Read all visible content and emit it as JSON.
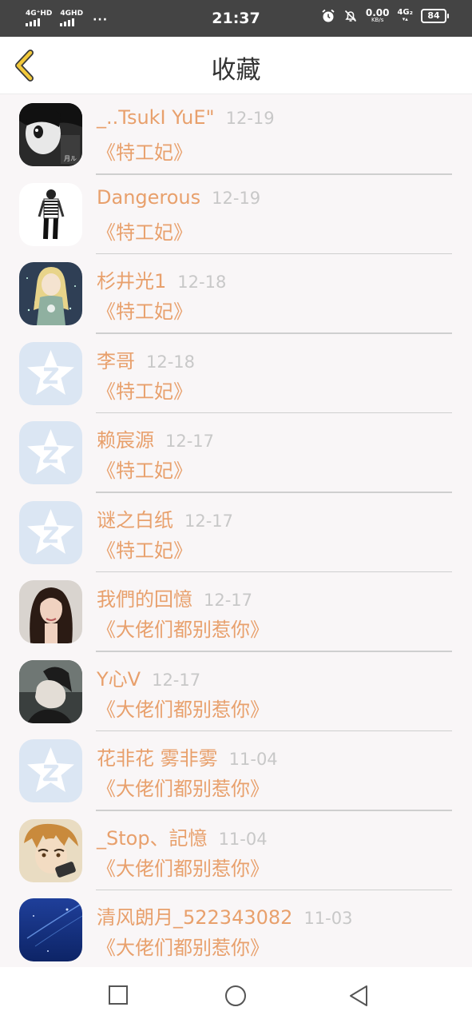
{
  "status_bar": {
    "sim1": "4G⁺HD",
    "sim2": "4GHD",
    "more": "···",
    "time": "21:37",
    "speed_value": "0.00",
    "speed_unit": "KB/s",
    "network": "4G₂",
    "network_arrows": "▾▴",
    "battery": "84",
    "icons": [
      "alarm-icon",
      "mute-bell-icon"
    ]
  },
  "header": {
    "title": "收藏",
    "back_icon": "chevron-left-icon",
    "accent_color": "#f2c93a"
  },
  "list": {
    "items": [
      {
        "name": "_..TsukI YuE\"",
        "date": "12-19",
        "book": "《特工妃》",
        "avatar": "manga-girl-bw-avatar"
      },
      {
        "name": "Dangerous",
        "date": "12-19",
        "book": "《特工妃》",
        "avatar": "striped-shirt-avatar"
      },
      {
        "name": "杉井光1",
        "date": "12-18",
        "book": "《特工妃》",
        "avatar": "anime-girl-avatar"
      },
      {
        "name": "李哥",
        "date": "12-18",
        "book": "《特工妃》",
        "avatar": "qq-default-avatar"
      },
      {
        "name": "赖宸源",
        "date": "12-17",
        "book": "《特工妃》",
        "avatar": "qq-default-avatar"
      },
      {
        "name": "谜之白纸",
        "date": "12-17",
        "book": "《特工妃》",
        "avatar": "qq-default-avatar"
      },
      {
        "name": "我們的回憶",
        "date": "12-17",
        "book": "《大佬们都别惹你》",
        "avatar": "woman-portrait-avatar"
      },
      {
        "name": "Y心V",
        "date": "12-17",
        "book": "《大佬们都别惹你》",
        "avatar": "man-profile-avatar"
      },
      {
        "name": "花非花 雾非雾",
        "date": "11-04",
        "book": "《大佬们都别惹你》",
        "avatar": "qq-default-avatar"
      },
      {
        "name": "_Stop、記憶",
        "date": "11-04",
        "book": "《大佬们都别惹你》",
        "avatar": "anime-boy-avatar"
      },
      {
        "name": "清风朗月_522343082",
        "date": "11-03",
        "book": "《大佬们都别惹你》",
        "avatar": "blue-sky-avatar"
      }
    ]
  },
  "nav_bar": {
    "icons": [
      "recents-square-icon",
      "home-circle-icon",
      "back-triangle-icon"
    ]
  },
  "colors": {
    "name_text": "#e8a06c",
    "date_text": "#c8c8c8",
    "status_bar_bg": "#444444",
    "page_bg": "#f9f6f7"
  }
}
